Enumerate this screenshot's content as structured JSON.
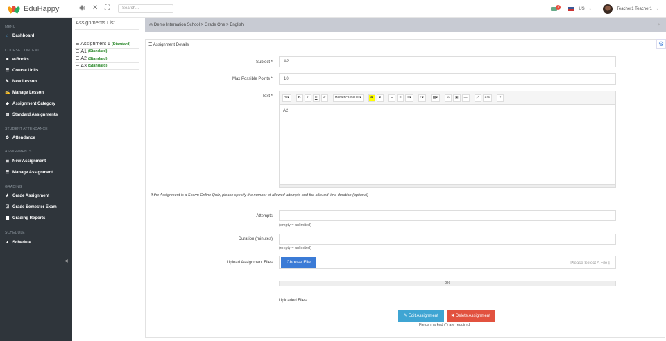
{
  "brand": {
    "title": "EduHappy"
  },
  "topbar": {
    "search_placeholder": "Search...",
    "notifications_count": "4",
    "language": "US",
    "user_name": "Teacher1 Teacher1"
  },
  "sidebar": {
    "sections": [
      {
        "heading": "MENU",
        "items": [
          {
            "label": "Dashboard",
            "icon": "home-icon"
          }
        ]
      },
      {
        "heading": "COURSE CONTENT",
        "items": [
          {
            "label": "e-Books",
            "icon": "book-icon"
          },
          {
            "label": "Course Units",
            "icon": "list-icon"
          },
          {
            "label": "New Lesson",
            "icon": "pencil-icon"
          },
          {
            "label": "Manage Lesson",
            "icon": "edit-icon"
          },
          {
            "label": "Assignment Category",
            "icon": "tag-icon"
          },
          {
            "label": "Standard Assignments",
            "icon": "layout-icon"
          }
        ]
      },
      {
        "heading": "STUDENT ATTENDANCE",
        "items": [
          {
            "label": "Attendance",
            "icon": "gear-icon"
          }
        ]
      },
      {
        "heading": "ASSIGNMENTS",
        "items": [
          {
            "label": "New Assignment",
            "icon": "list-icon"
          },
          {
            "label": "Manage Assignment",
            "icon": "list-icon"
          }
        ]
      },
      {
        "heading": "GRADING",
        "items": [
          {
            "label": "Grade Assignment",
            "icon": "trophy-icon"
          },
          {
            "label": "Grade Semester Exam",
            "icon": "check-icon"
          },
          {
            "label": "Grading Reports",
            "icon": "chart-icon"
          }
        ]
      },
      {
        "heading": "SCHEDULE",
        "items": [
          {
            "label": "Schedule",
            "icon": "bell-icon"
          }
        ]
      }
    ]
  },
  "assignments_list": {
    "heading": "Assignments List",
    "items": [
      {
        "name": "Assignment 1",
        "tag": "(Standard)"
      },
      {
        "name": "A1",
        "tag": "(Standard)"
      },
      {
        "name": "A2",
        "tag": "(Standard)"
      },
      {
        "name": "A3",
        "tag": "(Standard)"
      }
    ]
  },
  "breadcrumb": "Demo Internation School > Grade One > English",
  "panel": {
    "heading": "Assignment Details",
    "subject_label": "Subject *",
    "subject_value": "A2",
    "max_points_label": "Max Possible Points *",
    "max_points_value": "10",
    "text_label": "Text *",
    "editor_font": "Helvetica Neue",
    "editor_content": "A2",
    "scorm_note": "If the Assignment is a Scorm Online Quiz, please specify the number of allowed attempts and the allowed time duration (optional)",
    "attempts_label": "Attempts",
    "attempts_hint": "(empty = unlimited)",
    "duration_label": "Duration (minutes)",
    "duration_hint": "(empty = unlimited)",
    "upload_label": "Upload Assignment Files",
    "choose_file": "Choose File",
    "file_placeholder": "Please Select A File",
    "progress_text": "0%",
    "progress_value": 0,
    "uploaded_files_label": "Uploaded Files:",
    "edit_button": "Edit Assignment",
    "delete_button": "Delete Assignment",
    "required_note": "Fields marked (*) are required"
  }
}
